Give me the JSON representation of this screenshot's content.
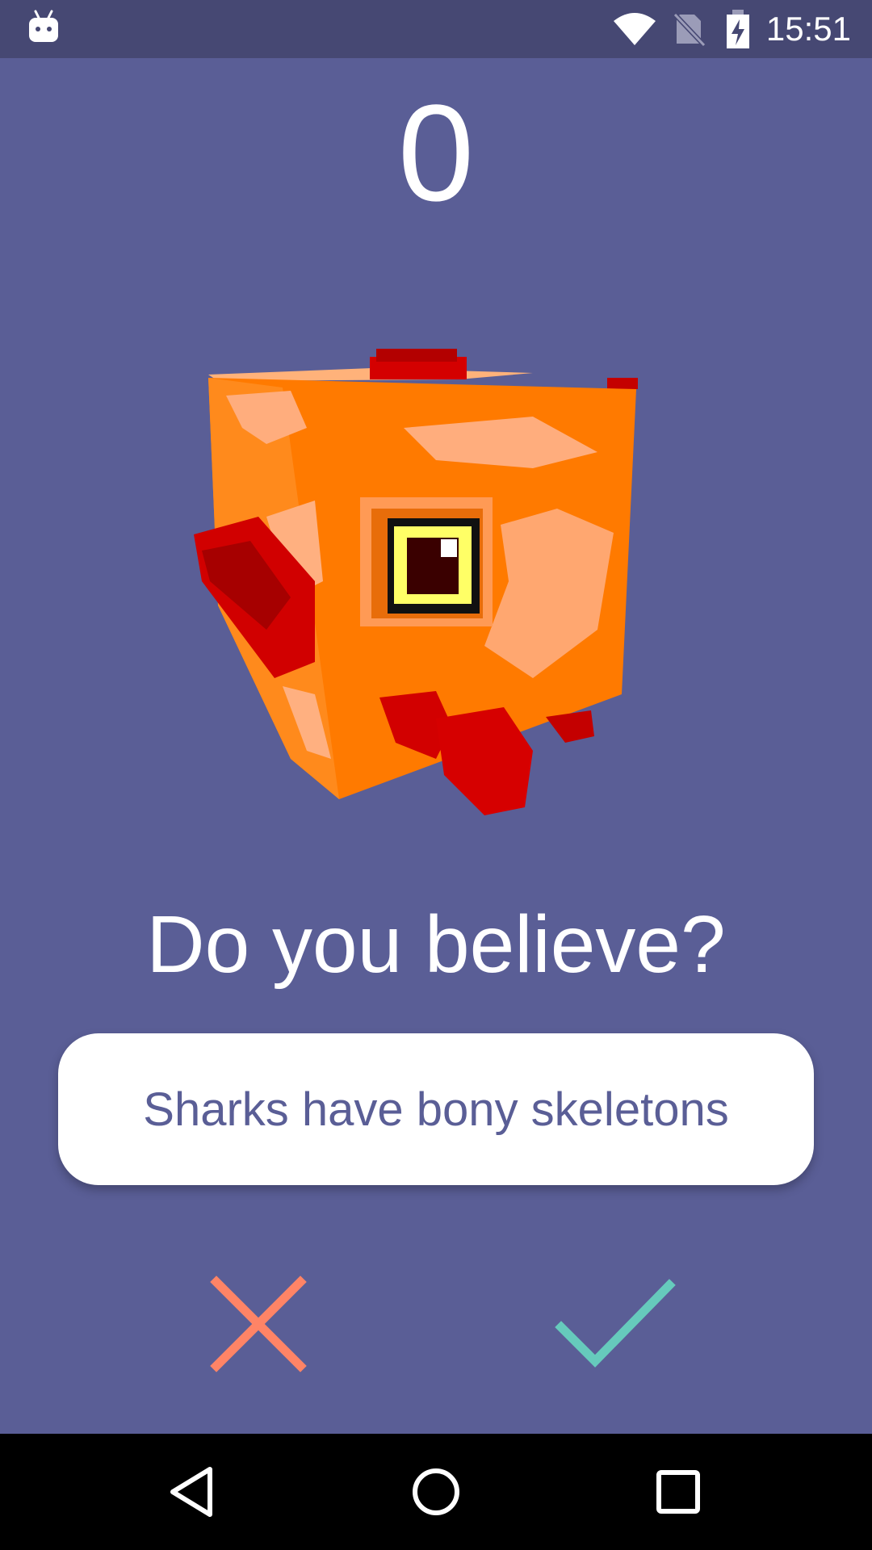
{
  "status_bar": {
    "time": "15:51",
    "icons": [
      "android-icon",
      "wifi-icon",
      "no-sim-icon",
      "battery-charging-icon"
    ]
  },
  "game": {
    "score": "0",
    "question": "Do you believe?",
    "statement": "Sharks have bony skeletons",
    "false_icon": "x-icon",
    "true_icon": "checkmark-icon",
    "colors": {
      "background": "#5a5e96",
      "status_bar": "#464873",
      "false": "#ff8466",
      "true": "#66cabc",
      "card": "#ffffff",
      "card_text": "#5a5e96"
    }
  },
  "nav_bar": {
    "icons": [
      "back-icon",
      "home-icon",
      "recents-icon"
    ]
  }
}
